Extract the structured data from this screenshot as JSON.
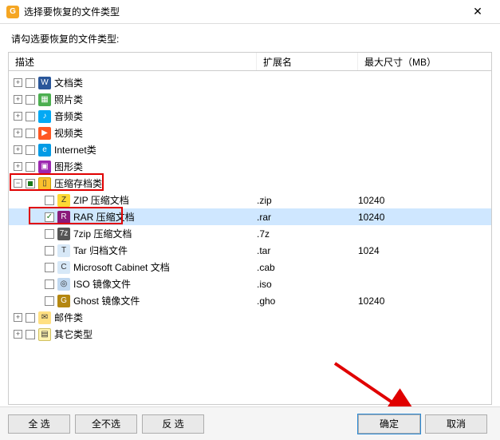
{
  "window": {
    "title": "选择要恢复的文件类型",
    "close_glyph": "✕"
  },
  "instruction": "请勾选要恢复的文件类型:",
  "columns": {
    "desc": "描述",
    "ext": "扩展名",
    "size": "最大尺寸（MB）"
  },
  "categories": [
    {
      "id": "docs",
      "label": "文档类",
      "icon": "W",
      "iconClass": "ic-word",
      "expanded": false
    },
    {
      "id": "photos",
      "label": "照片类",
      "icon": "▦",
      "iconClass": "ic-photo",
      "expanded": false
    },
    {
      "id": "audio",
      "label": "音频类",
      "icon": "♪",
      "iconClass": "ic-audio",
      "expanded": false
    },
    {
      "id": "video",
      "label": "视频类",
      "icon": "▶",
      "iconClass": "ic-video",
      "expanded": false
    },
    {
      "id": "net",
      "label": "Internet类",
      "icon": "e",
      "iconClass": "ic-net",
      "expanded": false
    },
    {
      "id": "shapes",
      "label": "图形类",
      "icon": "▣",
      "iconClass": "ic-shape",
      "expanded": false
    },
    {
      "id": "arch",
      "label": "压缩存档类",
      "icon": "▯",
      "iconClass": "ic-arch",
      "expanded": true
    },
    {
      "id": "mail",
      "label": "邮件类",
      "icon": "✉",
      "iconClass": "ic-mail",
      "expanded": false
    },
    {
      "id": "other",
      "label": "其它类型",
      "icon": "▤",
      "iconClass": "ic-other",
      "expanded": false
    }
  ],
  "archive_children": [
    {
      "id": "zip",
      "label": "ZIP 压缩文档",
      "ext": ".zip",
      "size": "10240",
      "icon": "Z",
      "iconClass": "ic-zip",
      "checked": false
    },
    {
      "id": "rar",
      "label": "RAR 压缩文档",
      "ext": ".rar",
      "size": "10240",
      "icon": "R",
      "iconClass": "ic-rar",
      "checked": true,
      "selected": true
    },
    {
      "id": "7z",
      "label": "7zip 压缩文档",
      "ext": ".7z",
      "size": "",
      "icon": "7z",
      "iconClass": "ic-7z",
      "checked": false
    },
    {
      "id": "tar",
      "label": "Tar 归档文件",
      "ext": ".tar",
      "size": "1024",
      "icon": "T",
      "iconClass": "ic-tar",
      "checked": false
    },
    {
      "id": "cab",
      "label": "Microsoft Cabinet 文档",
      "ext": ".cab",
      "size": "",
      "icon": "C",
      "iconClass": "ic-cab",
      "checked": false
    },
    {
      "id": "iso",
      "label": "ISO 镜像文件",
      "ext": ".iso",
      "size": "",
      "icon": "◎",
      "iconClass": "ic-iso",
      "checked": false
    },
    {
      "id": "ghost",
      "label": "Ghost 镜像文件",
      "ext": ".gho",
      "size": "10240",
      "icon": "G",
      "iconClass": "ic-ghost",
      "checked": false
    }
  ],
  "buttons": {
    "select_all": "全  选",
    "select_none": "全不选",
    "invert": "反  选",
    "ok": "确定",
    "cancel": "取消"
  }
}
